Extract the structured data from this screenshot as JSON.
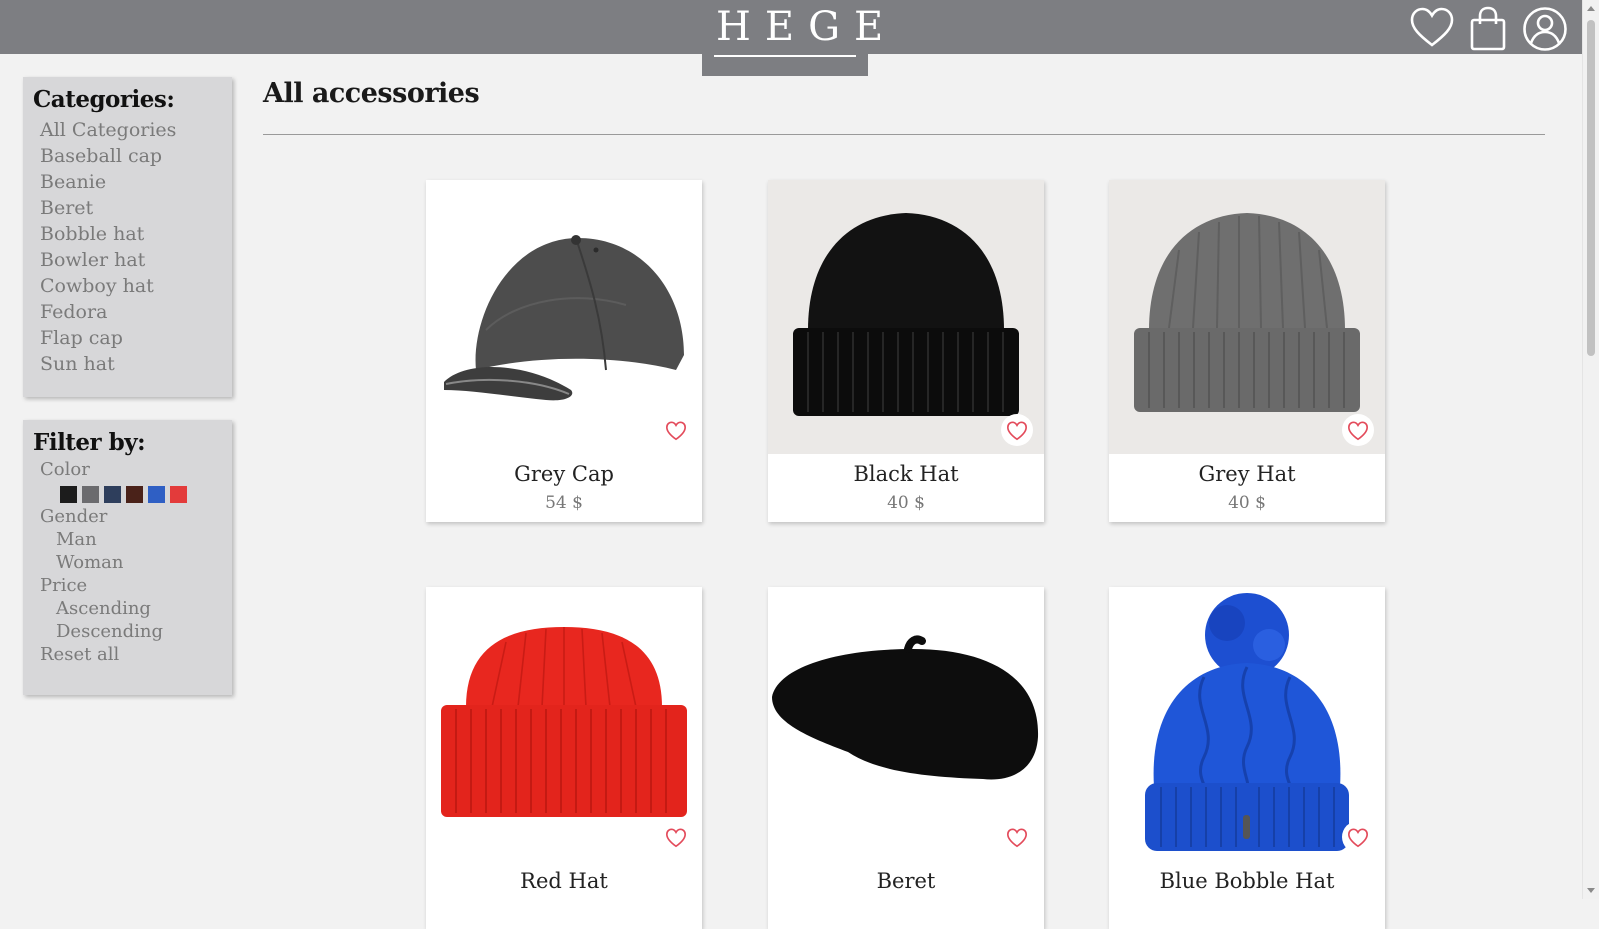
{
  "header": {
    "logo": "HEGE",
    "icons": [
      "heart-icon",
      "shopping-bag-icon",
      "user-icon"
    ],
    "bg_color": "#7d7e82"
  },
  "sidebar": {
    "categories_title": "Categories:",
    "categories": [
      "All Categories",
      "Baseball cap",
      "Beanie",
      "Beret",
      "Bobble hat",
      "Bowler hat",
      "Cowboy hat",
      "Fedora",
      "Flap cap",
      "Sun hat"
    ],
    "filter_title": "Filter by:",
    "color_label": "Color",
    "colors": [
      "#1c1c1c",
      "#6b6b6e",
      "#2e3e5c",
      "#4a2219",
      "#2f5fc4",
      "#e33b3b"
    ],
    "gender_label": "Gender",
    "gender_options": [
      "Man",
      "Woman"
    ],
    "price_label": "Price",
    "price_options": [
      "Ascending",
      "Descending"
    ],
    "reset_label": "Reset all"
  },
  "main": {
    "title": "All accessories",
    "products": [
      {
        "name": "Grey Cap",
        "price": "54 $",
        "image": "grey-baseball-cap",
        "color": "#4a4a4a"
      },
      {
        "name": "Black Hat",
        "price": "40 $",
        "image": "black-beanie",
        "color": "#111111"
      },
      {
        "name": "Grey Hat",
        "price": "40 $",
        "image": "grey-beanie",
        "color": "#777777"
      },
      {
        "name": "Red Hat",
        "price": "",
        "image": "red-beanie",
        "color": "#e3261f"
      },
      {
        "name": "Beret",
        "price": "",
        "image": "black-beret",
        "color": "#111111"
      },
      {
        "name": "Blue Bobble Hat",
        "price": "",
        "image": "blue-bobble-hat",
        "color": "#1f57d6"
      }
    ]
  }
}
